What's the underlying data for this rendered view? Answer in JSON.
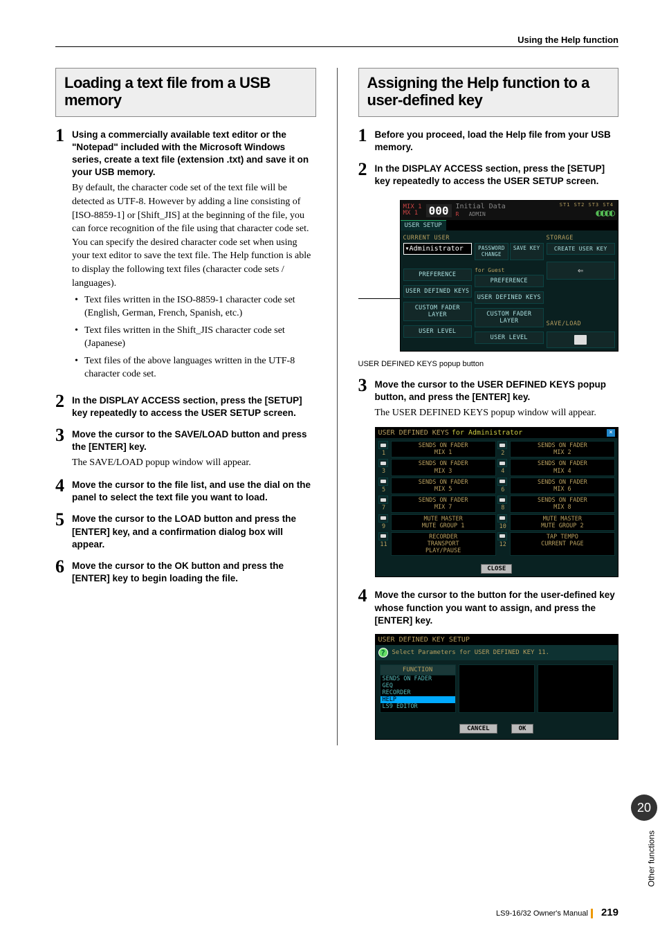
{
  "running_head": "Using the Help function",
  "left": {
    "title": "Loading a text file from a USB memory",
    "steps": [
      {
        "num": "1",
        "bold": "Using a commercially available text editor or the \"Notepad\" included with the Microsoft Windows series, create a text file (extension .txt) and save it on your USB memory.",
        "para": "By default, the character code set of the text file will be detected as UTF-8. However by adding a line consisting of [ISO-8859-1] or [Shift_JIS] at the beginning of the file, you can force recognition of the file using that character code set. You can specify the desired character code set when using your text editor to save the text file. The Help function is able to display the following text files (character code sets / languages).",
        "bullets": [
          "Text files written in the ISO-8859-1 character code set (English, German, French, Spanish, etc.)",
          "Text files written in the Shift_JIS character code set (Japanese)",
          "Text files of the above languages written in the UTF-8 character code set."
        ]
      },
      {
        "num": "2",
        "bold": "In the DISPLAY ACCESS section, press the [SETUP] key repeatedly to access the USER SETUP screen."
      },
      {
        "num": "3",
        "bold": "Move the cursor to the SAVE/LOAD button and press the [ENTER] key.",
        "para": "The SAVE/LOAD popup window will appear."
      },
      {
        "num": "4",
        "bold": "Move the cursor to the file list, and use the dial on the panel to select the text file you want to load."
      },
      {
        "num": "5",
        "bold": "Move the cursor to the LOAD button and press the [ENTER] key, and a confirmation dialog box will appear."
      },
      {
        "num": "6",
        "bold": "Move the cursor to the OK button and press the [ENTER] key to begin loading the file."
      }
    ]
  },
  "right": {
    "title": "Assigning the Help function to a user-defined key",
    "steps": [
      {
        "num": "1",
        "bold": "Before you proceed, load the Help file from your USB memory."
      },
      {
        "num": "2",
        "bold": "In the DISPLAY ACCESS section, press the [SETUP] key repeatedly to access the USER SETUP screen."
      },
      {
        "num": "3",
        "bold": "Move the cursor to the USER DEFINED KEYS popup button, and press the [ENTER] key.",
        "para": "The USER DEFINED KEYS popup window will appear."
      },
      {
        "num": "4",
        "bold": "Move the cursor to the button for the user-defined key whose function you want to assign, and press the [ENTER] key."
      }
    ],
    "ss1": {
      "mix1": "MIX 1",
      "mix2": "MX  1",
      "scene": "000",
      "init": "Initial Data",
      "rb": "R",
      "admin": "ADMIN",
      "st_labels": "ST1 ST2 ST3 ST4",
      "tab": "USER SETUP",
      "current_user": "CURRENT USER",
      "storage": "STORAGE",
      "administrator": "▾Administrator",
      "password": "PASSWORD CHANGE",
      "save_key": "SAVE KEY",
      "create": "CREATE USER KEY",
      "for_guest": "for Guest",
      "preference": "PREFERENCE",
      "udk": "USER DEFINED KEYS",
      "cfl": "CUSTOM FADER LAYER",
      "ul": "USER LEVEL",
      "saveload": "SAVE/LOAD"
    },
    "ss1_caption": "USER DEFINED KEYS popup button",
    "ss2": {
      "title": "USER DEFINED KEYS",
      "for": "for Administrator",
      "rows": [
        {
          "n1": "1",
          "c1": "SENDS ON FADER\nMIX 1",
          "n2": "2",
          "c2": "SENDS ON FADER\nMIX 2"
        },
        {
          "n1": "3",
          "c1": "SENDS ON FADER\nMIX 3",
          "n2": "4",
          "c2": "SENDS ON FADER\nMIX 4"
        },
        {
          "n1": "5",
          "c1": "SENDS ON FADER\nMIX 5",
          "n2": "6",
          "c2": "SENDS ON FADER\nMIX 6"
        },
        {
          "n1": "7",
          "c1": "SENDS ON FADER\nMIX 7",
          "n2": "8",
          "c2": "SENDS ON FADER\nMIX 8"
        },
        {
          "n1": "9",
          "c1": "MUTE MASTER\nMUTE GROUP 1",
          "n2": "10",
          "c2": "MUTE MASTER\nMUTE GROUP 2"
        },
        {
          "n1": "11",
          "c1": "RECORDER\nTRANSPORT\nPLAY/PAUSE",
          "n2": "12",
          "c2": "TAP TEMPO\nCURRENT PAGE"
        }
      ],
      "close": "CLOSE"
    },
    "ss3": {
      "title": "USER DEFINED KEY SETUP",
      "sub": "Select Parameters for USER DEFINED KEY 11.",
      "hdr": "FUNCTION",
      "items": [
        "SENDS ON FADER",
        "GEQ",
        "RECORDER",
        "HELP",
        "LS9 EDITOR"
      ],
      "sel_index": 3,
      "cancel": "CANCEL",
      "ok": "OK"
    }
  },
  "side": {
    "chapter": "20",
    "text": "Other functions"
  },
  "footer": {
    "book": "LS9-16/32  Owner's Manual",
    "page": "219"
  }
}
